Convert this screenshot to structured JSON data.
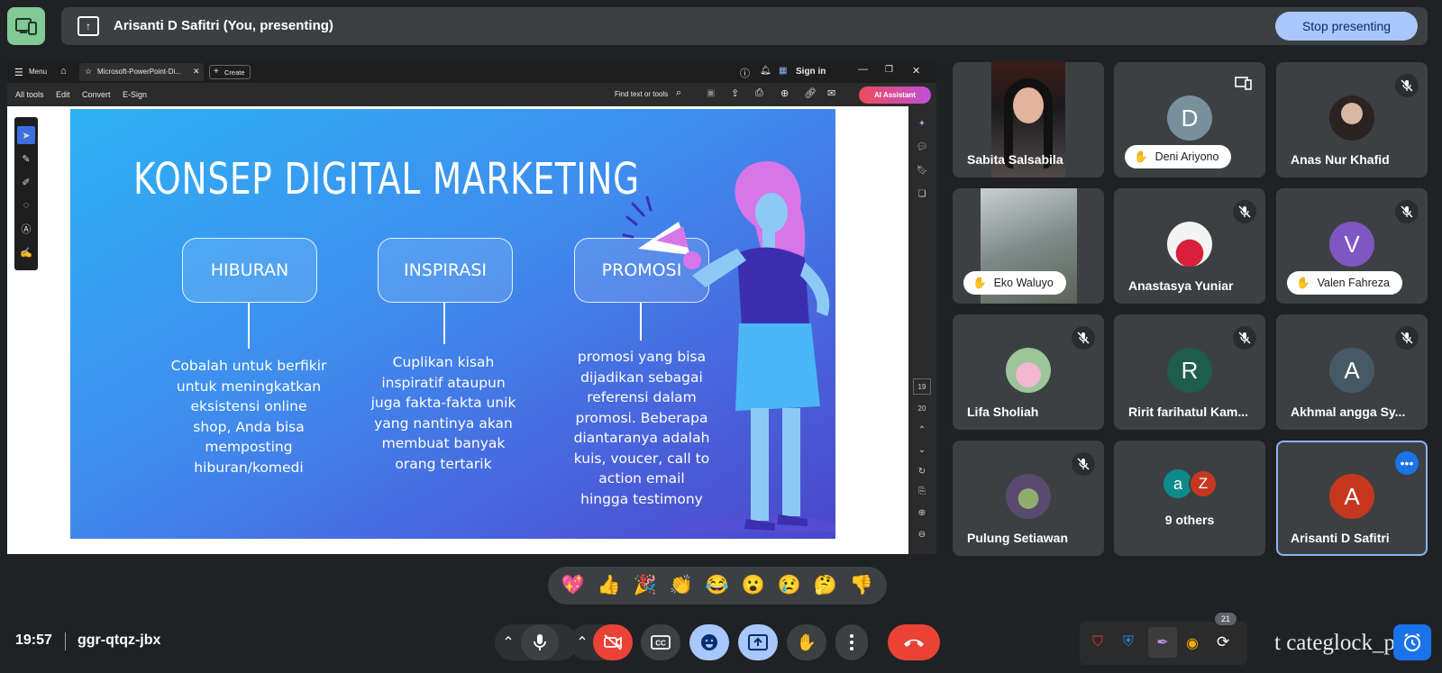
{
  "top_bar": {
    "presenter_title": "Arisanti D Safitri (You, presenting)",
    "stop_label": "Stop presenting"
  },
  "pdf": {
    "menu_label": "Menu",
    "tab_title": "Microsoft-PowerPoint-Di...",
    "create_label": "Create",
    "sign_in": "Sign in",
    "tools": [
      "All tools",
      "Edit",
      "Convert",
      "E-Sign"
    ],
    "find_text": "Find text or tools",
    "ai_label": "AI Assistant",
    "page_current": "19",
    "page_total": "20"
  },
  "slide": {
    "title": "KONSEP DIGITAL MARKETING",
    "columns": [
      {
        "heading": "HIBURAN",
        "lines": [
          "Cobalah untuk berfikir",
          "untuk meningkatkan",
          "eksistensi online",
          "shop, Anda bisa",
          "memposting",
          "hiburan/komedi"
        ]
      },
      {
        "heading": "INSPIRASI",
        "lines": [
          "Cuplikan kisah",
          "inspiratif ataupun",
          "juga fakta-fakta unik",
          "yang nantinya akan",
          "membuat banyak",
          "orang tertarik"
        ]
      },
      {
        "heading": "PROMOSI",
        "lines": [
          "promosi yang bisa",
          "dijadikan sebagai",
          "referensi dalam",
          "promosi. Beberapa",
          "diantaranya adalah",
          "kuis, voucer, call to",
          "action email",
          "hingga testimony"
        ]
      }
    ]
  },
  "participants": [
    {
      "name": "Sabita Salsabila",
      "kind": "video"
    },
    {
      "name": "Deni Ariyono",
      "kind": "avatar",
      "initial": "D",
      "color": "#78909c",
      "hand_raised": true
    },
    {
      "name": "Anas Nur Khafid",
      "kind": "photo",
      "muted": true
    },
    {
      "name": "Eko Waluyo",
      "kind": "video",
      "hand_raised": true
    },
    {
      "name": "Anastasya Yuniar",
      "kind": "photo",
      "muted": true
    },
    {
      "name": "Valen Fahreza",
      "kind": "avatar",
      "initial": "V",
      "color": "#7e57c2",
      "muted": true,
      "hand_raised": true
    },
    {
      "name": "Lifa Sholiah",
      "kind": "photo",
      "muted": true
    },
    {
      "name": "Ririt farihatul Kam...",
      "kind": "avatar",
      "initial": "R",
      "color": "#1e5d4a",
      "muted": true
    },
    {
      "name": "Akhmal angga Sy...",
      "kind": "avatar",
      "initial": "A",
      "color": "#455a64",
      "muted": true
    },
    {
      "name": "Pulung Setiawan",
      "kind": "photo",
      "muted": true
    },
    {
      "name": "9 others",
      "kind": "others",
      "initials": [
        "a",
        "Z"
      ]
    },
    {
      "name": "Arisanti D Safitri",
      "kind": "avatar",
      "initial": "A",
      "color": "#c5381f",
      "self": true
    }
  ],
  "reactions": [
    "💖",
    "👍",
    "🎉",
    "👏",
    "😂",
    "😮",
    "😢",
    "🤔",
    "👎"
  ],
  "meeting": {
    "time": "19:57",
    "code": "ggr-qtqz-jbx"
  },
  "tray": {
    "badge": "21",
    "overlay_text": "t categlock_prior"
  },
  "colors": {
    "accent": "#a8c7fa",
    "end_call": "#ea4335",
    "self_tile_border": "#8ab4f8"
  }
}
